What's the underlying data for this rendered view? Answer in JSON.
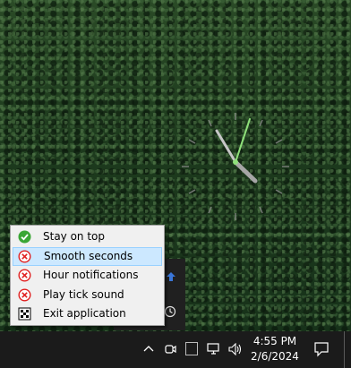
{
  "desktop": {
    "wallpaper": "forest aerial",
    "analog_clock": {
      "hour_hand_color": "#b5b5b5",
      "minute_hand_color": "#b5b5b5",
      "second_hand_color": "#8ee07a"
    }
  },
  "context_menu": {
    "items": [
      {
        "label": "Stay on top",
        "icon": "check-icon",
        "state": "enabled"
      },
      {
        "label": "Smooth seconds",
        "icon": "x-circle-icon",
        "state": "disabled",
        "highlighted": true
      },
      {
        "label": "Hour notifications",
        "icon": "x-circle-icon",
        "state": "disabled"
      },
      {
        "label": "Play tick sound",
        "icon": "x-circle-icon",
        "state": "disabled"
      },
      {
        "label": "Exit application",
        "icon": "exit-icon"
      }
    ]
  },
  "taskbar": {
    "time": "4:55 PM",
    "date": "2/6/2024",
    "tray_icons": [
      "chevron-up-icon",
      "meet-now-icon",
      "app-tray-icon",
      "network-icon",
      "volume-icon"
    ],
    "notification_icon": "notification-icon"
  }
}
